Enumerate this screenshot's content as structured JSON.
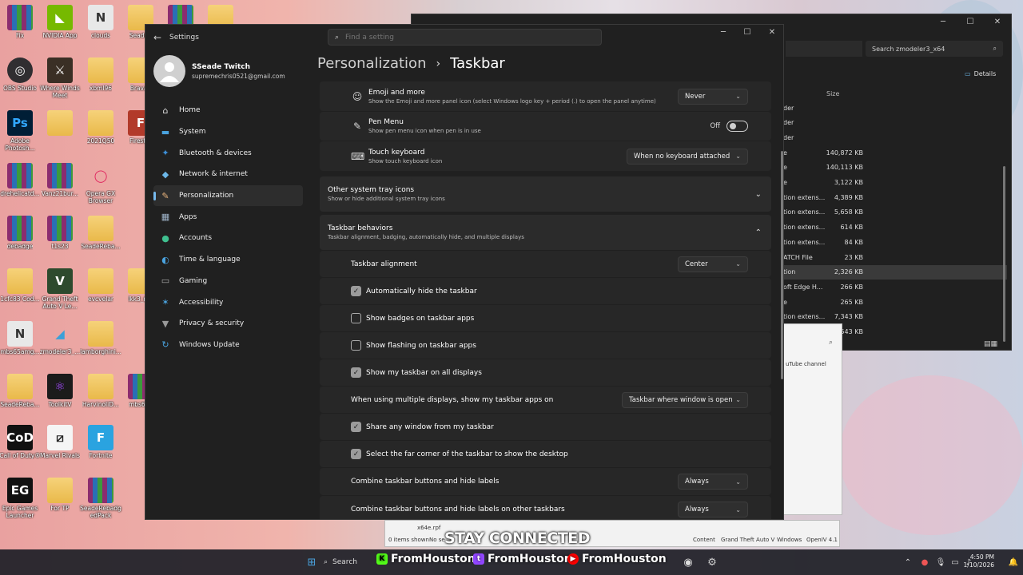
{
  "desktop": {
    "icons": [
      {
        "label": "Fix",
        "kind": "rar"
      },
      {
        "label": "NVIDIA App",
        "kind": "nvidia"
      },
      {
        "label": "clouds",
        "kind": "n"
      },
      {
        "label": "SeadeR",
        "kind": "folder"
      },
      {
        "label": "",
        "kind": "rar"
      },
      {
        "label": "",
        "kind": "folder"
      },
      {
        "label": "OBS Studio",
        "kind": "obs"
      },
      {
        "label": "Where Winds Meet",
        "kind": "wwm"
      },
      {
        "label": "xbml96",
        "kind": "folder"
      },
      {
        "label": "Bravad",
        "kind": "folder"
      },
      {
        "label": "Adobe Photosh...",
        "kind": "ps"
      },
      {
        "label": "",
        "kind": "folder"
      },
      {
        "label": "2021Q50",
        "kind": "folder"
      },
      {
        "label": "Firestor",
        "kind": "fire"
      },
      {
        "label": "drehelicatd...",
        "kind": "rar"
      },
      {
        "label": "Vanz21bur...",
        "kind": "rar"
      },
      {
        "label": "Opera GX Browser",
        "kind": "opera"
      },
      {
        "label": "debadge",
        "kind": "rar"
      },
      {
        "label": "t1s23",
        "kind": "rar"
      },
      {
        "label": "SeadeReba...",
        "kind": "folder"
      },
      {
        "label": "1cfc83 Cod...",
        "kind": "folder"
      },
      {
        "label": "Grand Theft Auto V Le...",
        "kind": "gta"
      },
      {
        "label": "evcvelar",
        "kind": "folder"
      },
      {
        "label": "lkk3_red",
        "kind": "folder"
      },
      {
        "label": "mbs65amg...",
        "kind": "n"
      },
      {
        "label": "zmodeler3_...",
        "kind": "zm"
      },
      {
        "label": "lamborghini...",
        "kind": "folder"
      },
      {
        "label": "SeadeReba...",
        "kind": "folder"
      },
      {
        "label": "ToolkitV",
        "kind": "tool"
      },
      {
        "label": "HarvinoliD...",
        "kind": "folder"
      },
      {
        "label": "mbs65a",
        "kind": "rar"
      },
      {
        "label": "Call of Duty®",
        "kind": "cod"
      },
      {
        "label": "Marvel Rivals",
        "kind": "mr"
      },
      {
        "label": "Fortnite",
        "kind": "fn"
      },
      {
        "label": "Epic Games Launcher",
        "kind": "epic"
      },
      {
        "label": "For TP",
        "kind": "folder"
      },
      {
        "label": "SeadeRebadg edPack",
        "kind": "rar"
      }
    ]
  },
  "explorer": {
    "search_placeholder": "Search zmodeler3_x64",
    "details_label": "Details",
    "size_header": "Size",
    "rows": [
      {
        "name": "der",
        "size": ""
      },
      {
        "name": "der",
        "size": ""
      },
      {
        "name": "der",
        "size": ""
      },
      {
        "name": "e",
        "size": "140,872 KB"
      },
      {
        "name": "e",
        "size": "140,113 KB"
      },
      {
        "name": "e",
        "size": "3,122 KB"
      },
      {
        "name": "tion extens...",
        "size": "4,389 KB"
      },
      {
        "name": "tion extens...",
        "size": "5,658 KB"
      },
      {
        "name": "tion extens...",
        "size": "614 KB"
      },
      {
        "name": "tion extens...",
        "size": "84 KB"
      },
      {
        "name": "ATCH File",
        "size": "23 KB"
      },
      {
        "name": "tion",
        "size": "2,326 KB"
      },
      {
        "name": "oft Edge H...",
        "size": "266 KB"
      },
      {
        "name": "e",
        "size": "265 KB"
      },
      {
        "name": "tion extens...",
        "size": "7,343 KB"
      },
      {
        "name": "",
        "size": "543 KB"
      }
    ],
    "youtube_label": "uTube channel",
    "status": {
      "items": "0 items shown",
      "no_sel": "No se",
      "file": "x64e.rpf",
      "content": "Content",
      "game": "Grand Theft Auto V",
      "os": "Windows",
      "ver": "OpenIV 4.1"
    }
  },
  "settings": {
    "app_title": "Settings",
    "search_placeholder": "Find a setting",
    "user": {
      "name": "SSeade Twitch",
      "email": "supremechris0521@gmail.com"
    },
    "nav": [
      {
        "label": "Home",
        "icon": "home-icon",
        "glyph": "⌂",
        "color": "#dddddd",
        "active": false
      },
      {
        "label": "System",
        "icon": "system-icon",
        "glyph": "▬",
        "color": "#4aa3df",
        "active": false
      },
      {
        "label": "Bluetooth & devices",
        "icon": "bluetooth-icon",
        "glyph": "✦",
        "color": "#3d8fd8",
        "active": false
      },
      {
        "label": "Network & internet",
        "icon": "network-icon",
        "glyph": "◆",
        "color": "#6cb7e8",
        "active": false
      },
      {
        "label": "Personalization",
        "icon": "brush-icon",
        "glyph": "✎",
        "color": "#e8b37c",
        "active": true
      },
      {
        "label": "Apps",
        "icon": "apps-icon",
        "glyph": "▦",
        "color": "#9fb4c9",
        "active": false
      },
      {
        "label": "Accounts",
        "icon": "accounts-icon",
        "glyph": "●",
        "color": "#3fbf8f",
        "active": false
      },
      {
        "label": "Time & language",
        "icon": "globe-icon",
        "glyph": "◐",
        "color": "#4aa3df",
        "active": false
      },
      {
        "label": "Gaming",
        "icon": "gamepad-icon",
        "glyph": "▭",
        "color": "#aaaaaa",
        "active": false
      },
      {
        "label": "Accessibility",
        "icon": "accessibility-icon",
        "glyph": "✶",
        "color": "#4aa3df",
        "active": false
      },
      {
        "label": "Privacy & security",
        "icon": "shield-icon",
        "glyph": "▼",
        "color": "#999999",
        "active": false
      },
      {
        "label": "Windows Update",
        "icon": "update-icon",
        "glyph": "↻",
        "color": "#4aa3df",
        "active": false
      }
    ],
    "breadcrumb": {
      "parent": "Personalization",
      "current": "Taskbar"
    },
    "emoji": {
      "title": "Emoji and more",
      "desc": "Show the Emoji and more panel icon (select Windows logo key + period (.) to open the panel anytime)",
      "value": "Never"
    },
    "pen": {
      "title": "Pen Menu",
      "desc": "Show pen menu icon when pen is in use",
      "state": "Off"
    },
    "touch": {
      "title": "Touch keyboard",
      "desc": "Show touch keyboard icon",
      "value": "When no keyboard attached"
    },
    "other_tray": {
      "title": "Other system tray icons",
      "desc": "Show or hide additional system tray icons"
    },
    "behaviors": {
      "title": "Taskbar behaviors",
      "desc": "Taskbar alignment, badging, automatically hide, and multiple displays"
    },
    "alignment": {
      "label": "Taskbar alignment",
      "value": "Center"
    },
    "auto_hide": {
      "label": "Automatically hide the taskbar",
      "checked": true
    },
    "badges": {
      "label": "Show badges on taskbar apps",
      "checked": false
    },
    "flashing": {
      "label": "Show flashing on taskbar apps",
      "checked": false
    },
    "all_displays": {
      "label": "Show my taskbar on all displays",
      "checked": true
    },
    "multi_display": {
      "label": "When using multiple displays, show my taskbar apps on",
      "value": "Taskbar where window is open"
    },
    "share_window": {
      "label": "Share any window from my taskbar",
      "checked": true
    },
    "far_corner": {
      "label": "Select the far corner of the taskbar to show the desktop",
      "checked": true
    },
    "combine": {
      "label": "Combine taskbar buttons and hide labels",
      "value": "Always"
    },
    "combine_other": {
      "label": "Combine taskbar buttons and hide labels on other taskbars",
      "value": "Always"
    }
  },
  "overlay": {
    "stay_connected": "STAY CONNECTED",
    "kick": "FromHouston",
    "twitch": "FromHouston",
    "youtube": "FromHouston"
  },
  "taskbar": {
    "search_label": "Search",
    "time": "4:50 PM",
    "date": "1/10/2026"
  },
  "colors": {
    "accent": "#76b9ed",
    "settings_bg": "#202020",
    "card_bg": "#2b2b2b"
  }
}
